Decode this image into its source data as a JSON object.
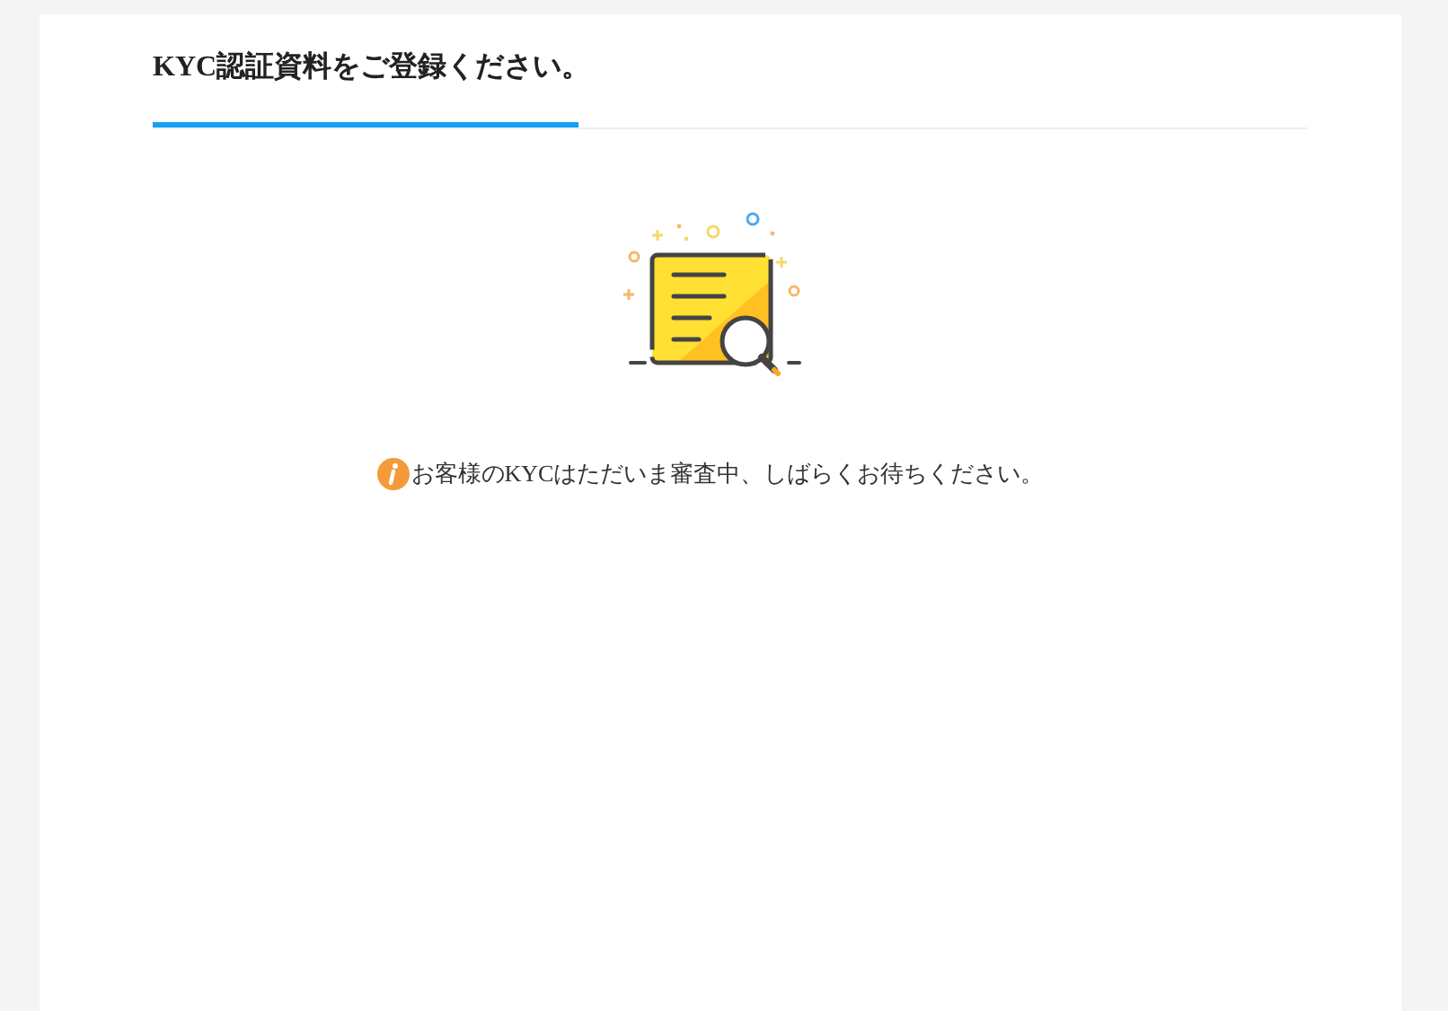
{
  "header": {
    "title": "KYC認証資料をご登録ください。"
  },
  "status": {
    "message": "お客様のKYCはただいま審査中、しばらくお待ちください。"
  }
}
